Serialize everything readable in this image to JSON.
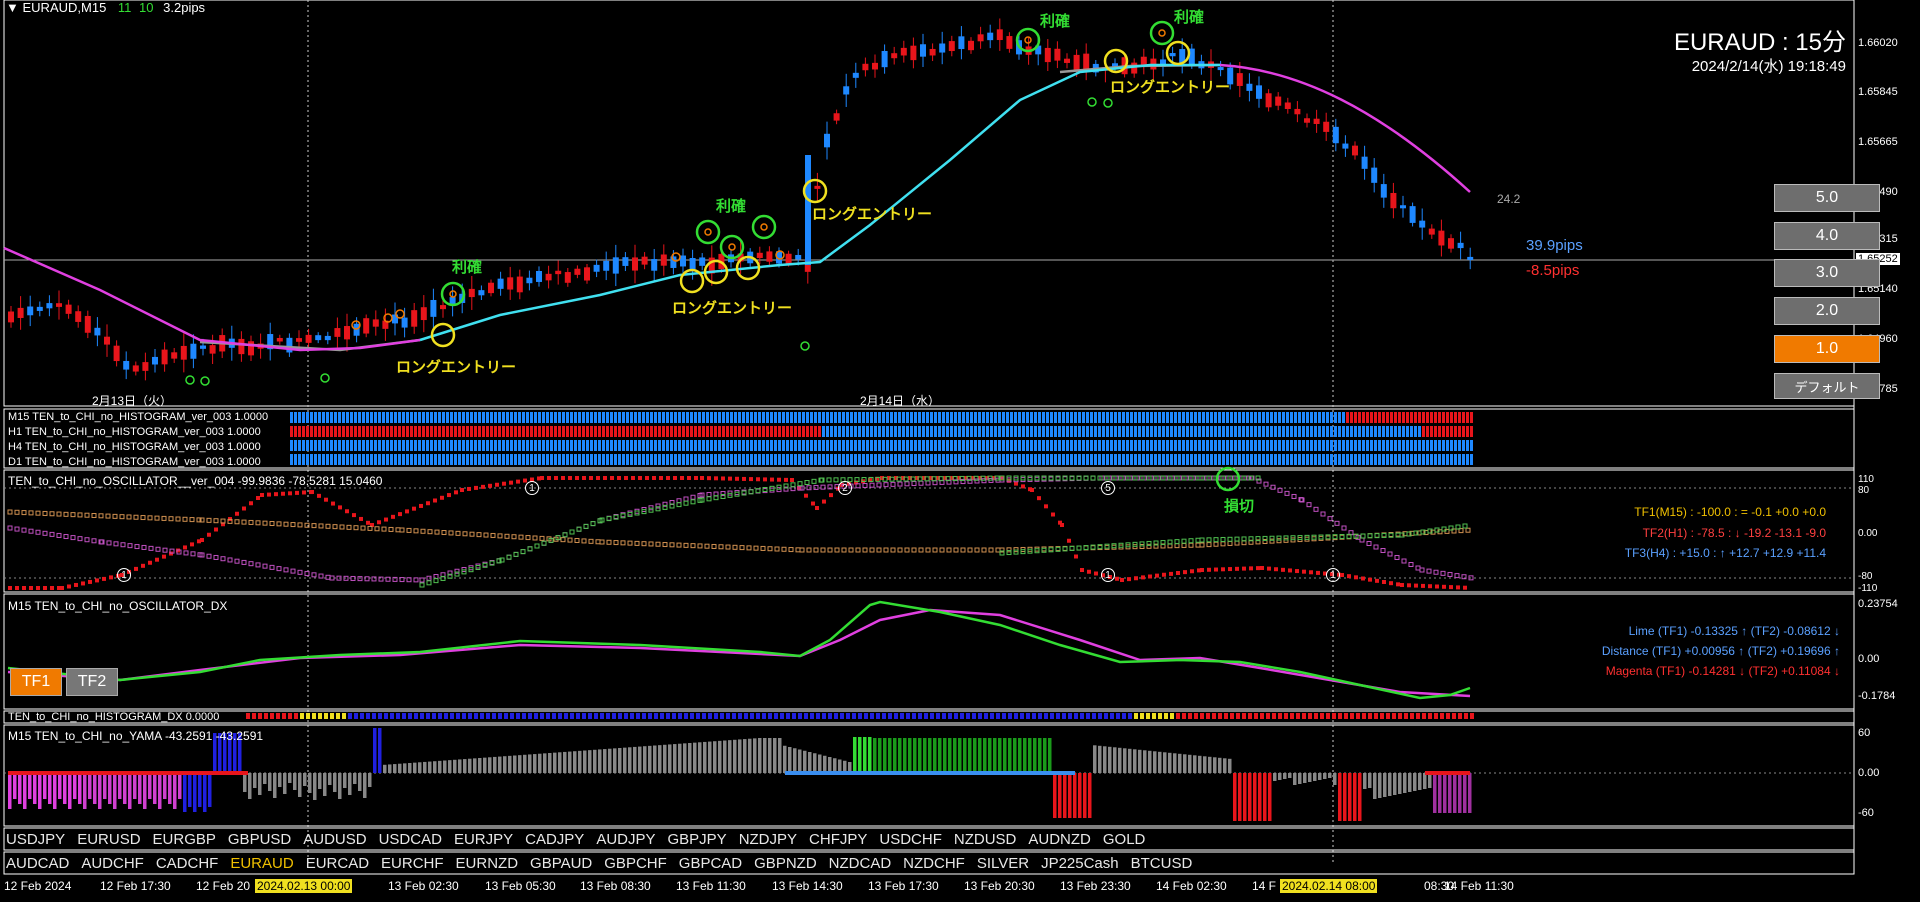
{
  "header": {
    "symbol": "EURAUD,M15",
    "spread_a": "11",
    "spread_b": "10",
    "spread_pips": "3.2pips"
  },
  "title": {
    "main": "EURAUD : 15分",
    "datetime": "2024/2/14(水) 19:18:49"
  },
  "price_axis": [
    "1.66020",
    "1.65845",
    "1.65665",
    "1.65490",
    "1.65315",
    "1.65252",
    "1.65140",
    "1.64960",
    "1.64785"
  ],
  "price_tag": "1.65252",
  "stats": {
    "value": "24.2",
    "gain": "39.9pips",
    "loss": "-8.5pips"
  },
  "buttons": [
    "5.0",
    "4.0",
    "3.0",
    "2.0",
    "1.0",
    "デフォルト"
  ],
  "annotations": {
    "take_profit": "利確",
    "long_entry": "ロングエントリー",
    "stop_loss": "損切"
  },
  "date_labels": {
    "day1": "2月13日（火）",
    "day2": "2月14日（水）"
  },
  "histograms": [
    "M15 TEN_to_CHI_no_HISTOGRAM_ver_003 1.0000",
    "H1 TEN_to_CHI_no_HISTOGRAM_ver_003 1.0000",
    "H4 TEN_to_CHI_no_HISTOGRAM_ver_003 1.0000",
    "D1 TEN_to_CHI_no_HISTOGRAM_ver_003 1.0000"
  ],
  "oscillator": {
    "title": "TEN_to_CHI_no_OSCILLATOR__ver_004 -99.9836 -78.5281 15.0460",
    "axis": [
      "110",
      "80",
      "0.00",
      "-80",
      "-110"
    ],
    "tf1": "TF1(M15) : -100.0 : = -0.1 +0.0 +0.0",
    "tf2": "TF2(H1) : -78.5 : ↓ -19.2 -13.1 -9.0",
    "tf3": "TF3(H4) : +15.0 : ↑ +12.7 +12.9 +11.4",
    "markers": [
      "1",
      "1",
      "2",
      "5",
      "1",
      "1"
    ]
  },
  "dx": {
    "title": "M15 TEN_to_CHI_no_OSCILLATOR_DX",
    "axis": [
      "0.23754",
      "0.00",
      "-0.1784"
    ],
    "lime": "Lime (TF1) -0.13325 ↑ (TF2) -0.08612 ↓",
    "distance": "Distance (TF1) +0.00956 ↑ (TF2) +0.19696 ↑",
    "magenta": "Magenta (TF1) -0.14281 ↓ (TF2) +0.11084 ↓",
    "tf1_btn": "TF1",
    "tf2_btn": "TF2"
  },
  "hist_dx": {
    "title": "TEN_to_CHI_no_HISTOGRAM_DX 0.0000"
  },
  "yama": {
    "title": "M15  TEN_to_CHI_no_YAMA -43.2591 -43.2591",
    "axis": [
      "60",
      "0.00",
      "-60"
    ]
  },
  "symbols_row1": [
    "USDJPY",
    "EURUSD",
    "EURGBP",
    "GBPUSD",
    "AUDUSD",
    "USDCAD",
    "EURJPY",
    "CADJPY",
    "AUDJPY",
    "GBPJPY",
    "NZDJPY",
    "CHFJPY",
    "USDCHF",
    "NZDUSD",
    "AUDNZD",
    "GOLD"
  ],
  "symbols_row2": [
    "AUDCAD",
    "AUDCHF",
    "CADCHF",
    "EURAUD",
    "EURCAD",
    "EURCHF",
    "EURNZD",
    "GBPAUD",
    "GBPCHF",
    "GBPCAD",
    "GBPNZD",
    "NZDCAD",
    "NZDCHF",
    "SILVER",
    "JP225Cash",
    "BTCUSD"
  ],
  "selected_symbol": "EURAUD",
  "time_axis": [
    "12 Feb 2024",
    "12 Feb 17:30",
    "12 Feb 20",
    "13 Feb 02:30",
    "13 Feb 05:30",
    "13 Feb 08:30",
    "13 Feb 11:30",
    "13 Feb 14:30",
    "13 Feb 17:30",
    "13 Feb 20:30",
    "13 Feb 23:30",
    "14 Feb 02:30",
    "14 F",
    "08:30",
    "14 Feb 11:30"
  ],
  "time_highlights": [
    "2024.02.13 00:00",
    "2024.02.14 08:00"
  ],
  "colors": {
    "up": "#1e88ff",
    "down": "#e8151b",
    "cyan": "#40e0f0",
    "magenta": "#e040e0",
    "lime": "#33dd33",
    "yellow": "#f0e020",
    "orange": "#f07a00"
  }
}
